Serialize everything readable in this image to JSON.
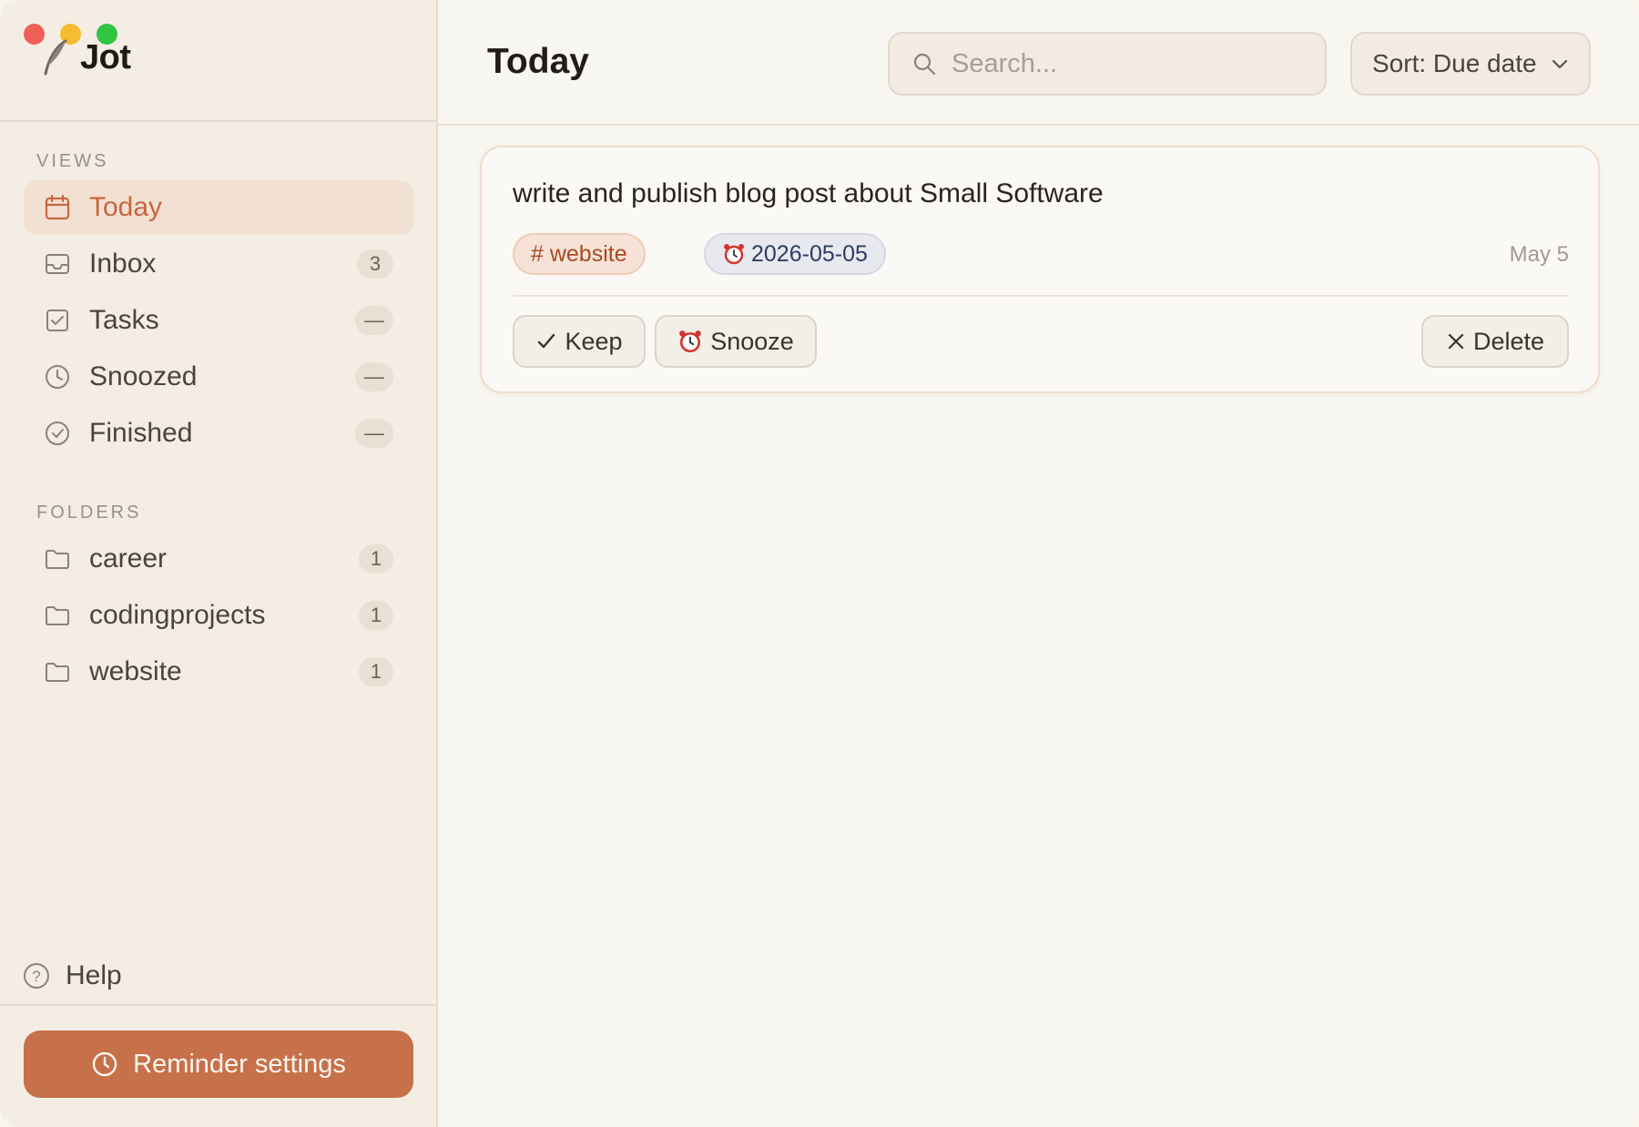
{
  "app": {
    "name": "Jot"
  },
  "sidebar": {
    "views_label": "VIEWS",
    "views": [
      {
        "label": "Today",
        "icon": "calendar-icon",
        "badge": "",
        "active": true
      },
      {
        "label": "Inbox",
        "icon": "inbox-icon",
        "badge": "3"
      },
      {
        "label": "Tasks",
        "icon": "checkbox-icon",
        "badge": "—"
      },
      {
        "label": "Snoozed",
        "icon": "clock-icon",
        "badge": "—"
      },
      {
        "label": "Finished",
        "icon": "check-circle-icon",
        "badge": "—"
      }
    ],
    "folders_label": "FOLDERS",
    "folders": [
      {
        "label": "career",
        "icon": "folder-icon",
        "badge": "1"
      },
      {
        "label": "codingprojects",
        "icon": "folder-icon",
        "badge": "1"
      },
      {
        "label": "website",
        "icon": "folder-icon",
        "badge": "1"
      }
    ],
    "help_label": "Help",
    "reminder_button": "Reminder settings"
  },
  "header": {
    "title": "Today",
    "search_placeholder": "Search...",
    "sort_label": "Sort: Due date"
  },
  "card": {
    "title": "write and publish blog post about Small Software",
    "folder_tag": "# website",
    "due_tag": "2026-05-05",
    "date": "May 5",
    "keep_label": "Keep",
    "snooze_label": "Snooze",
    "delete_label": "Delete"
  },
  "colors": {
    "accent": "#c6714a",
    "sidebar_bg": "#f3ede4",
    "main_bg": "#f8f6f0",
    "active_bg": "#f2e1d3",
    "active_text": "#c7663e"
  }
}
